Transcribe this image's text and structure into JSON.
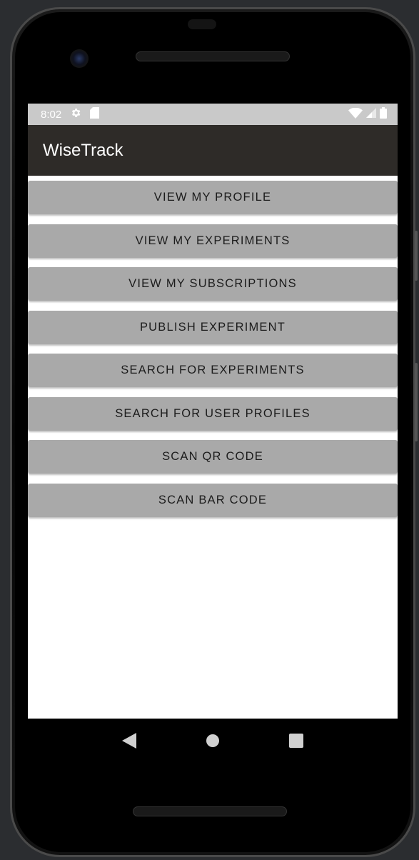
{
  "status_bar": {
    "time": "8:02",
    "icons": [
      "settings-icon",
      "sd-card-icon",
      "wifi-icon",
      "signal-icon",
      "battery-icon"
    ]
  },
  "app_bar": {
    "title": "WiseTrack"
  },
  "buttons": [
    "VIEW MY PROFILE",
    "VIEW MY EXPERIMENTS",
    "VIEW MY SUBSCRIPTIONS",
    "PUBLISH EXPERIMENT",
    "SEARCH FOR EXPERIMENTS",
    "SEARCH FOR USER PROFILES",
    "SCAN QR CODE",
    "SCAN BAR CODE"
  ],
  "nav_bar": {
    "icons": [
      "back-icon",
      "home-icon",
      "recents-icon"
    ]
  },
  "colors": {
    "app_bar": "#2e2b28",
    "status_bar": "#c9c9c9",
    "button": "#a9a9a9",
    "button_text": "#1c1c1c"
  }
}
